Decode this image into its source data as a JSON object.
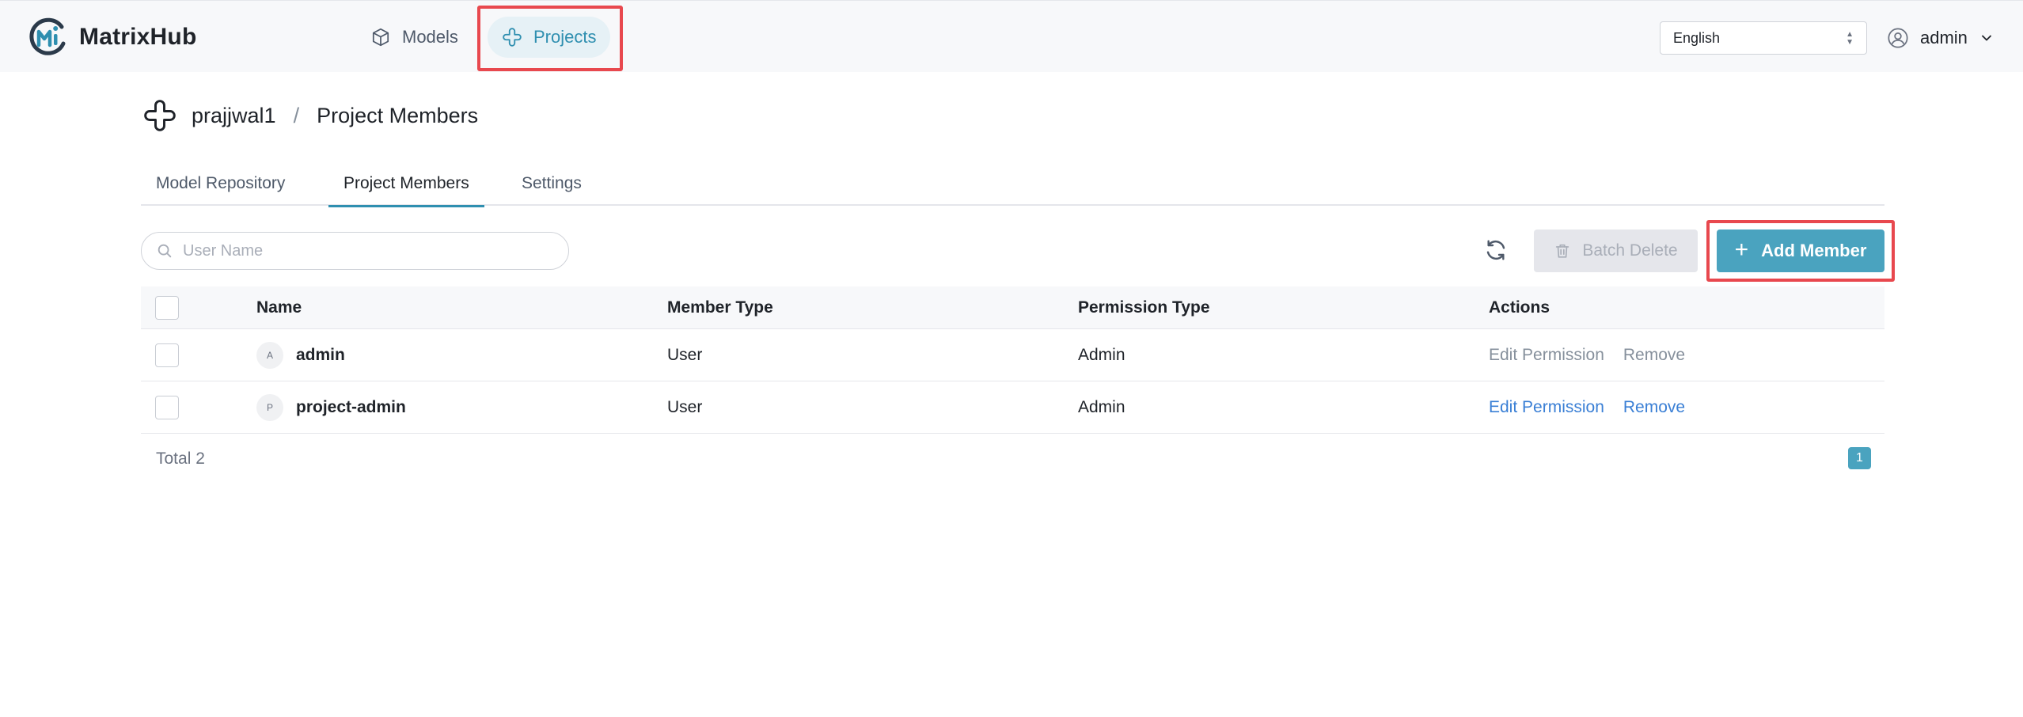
{
  "app": {
    "name": "MatrixHub"
  },
  "nav": {
    "models_label": "Models",
    "projects_label": "Projects"
  },
  "language": {
    "selected": "English"
  },
  "user": {
    "name": "admin"
  },
  "breadcrumb": {
    "project": "prajjwal1",
    "separator": "/",
    "page": "Project Members"
  },
  "tabs": [
    {
      "label": "Model Repository",
      "active": false
    },
    {
      "label": "Project Members",
      "active": true
    },
    {
      "label": "Settings",
      "active": false
    }
  ],
  "toolbar": {
    "search_placeholder": "User Name",
    "batch_delete_label": "Batch Delete",
    "add_member_label": "Add Member"
  },
  "table": {
    "columns": [
      "Name",
      "Member Type",
      "Permission Type",
      "Actions"
    ],
    "rows": [
      {
        "avatar": "A",
        "name": "admin",
        "member_type": "User",
        "permission_type": "Admin",
        "edit_label": "Edit Permission",
        "remove_label": "Remove",
        "actions_enabled": false
      },
      {
        "avatar": "P",
        "name": "project-admin",
        "member_type": "User",
        "permission_type": "Admin",
        "edit_label": "Edit Permission",
        "remove_label": "Remove",
        "actions_enabled": true
      }
    ]
  },
  "pagination": {
    "total_label": "Total 2",
    "current_page": "1"
  },
  "colors": {
    "accent": "#4aa3bf",
    "link": "#3a7fd5",
    "highlight": "#e8484e"
  }
}
